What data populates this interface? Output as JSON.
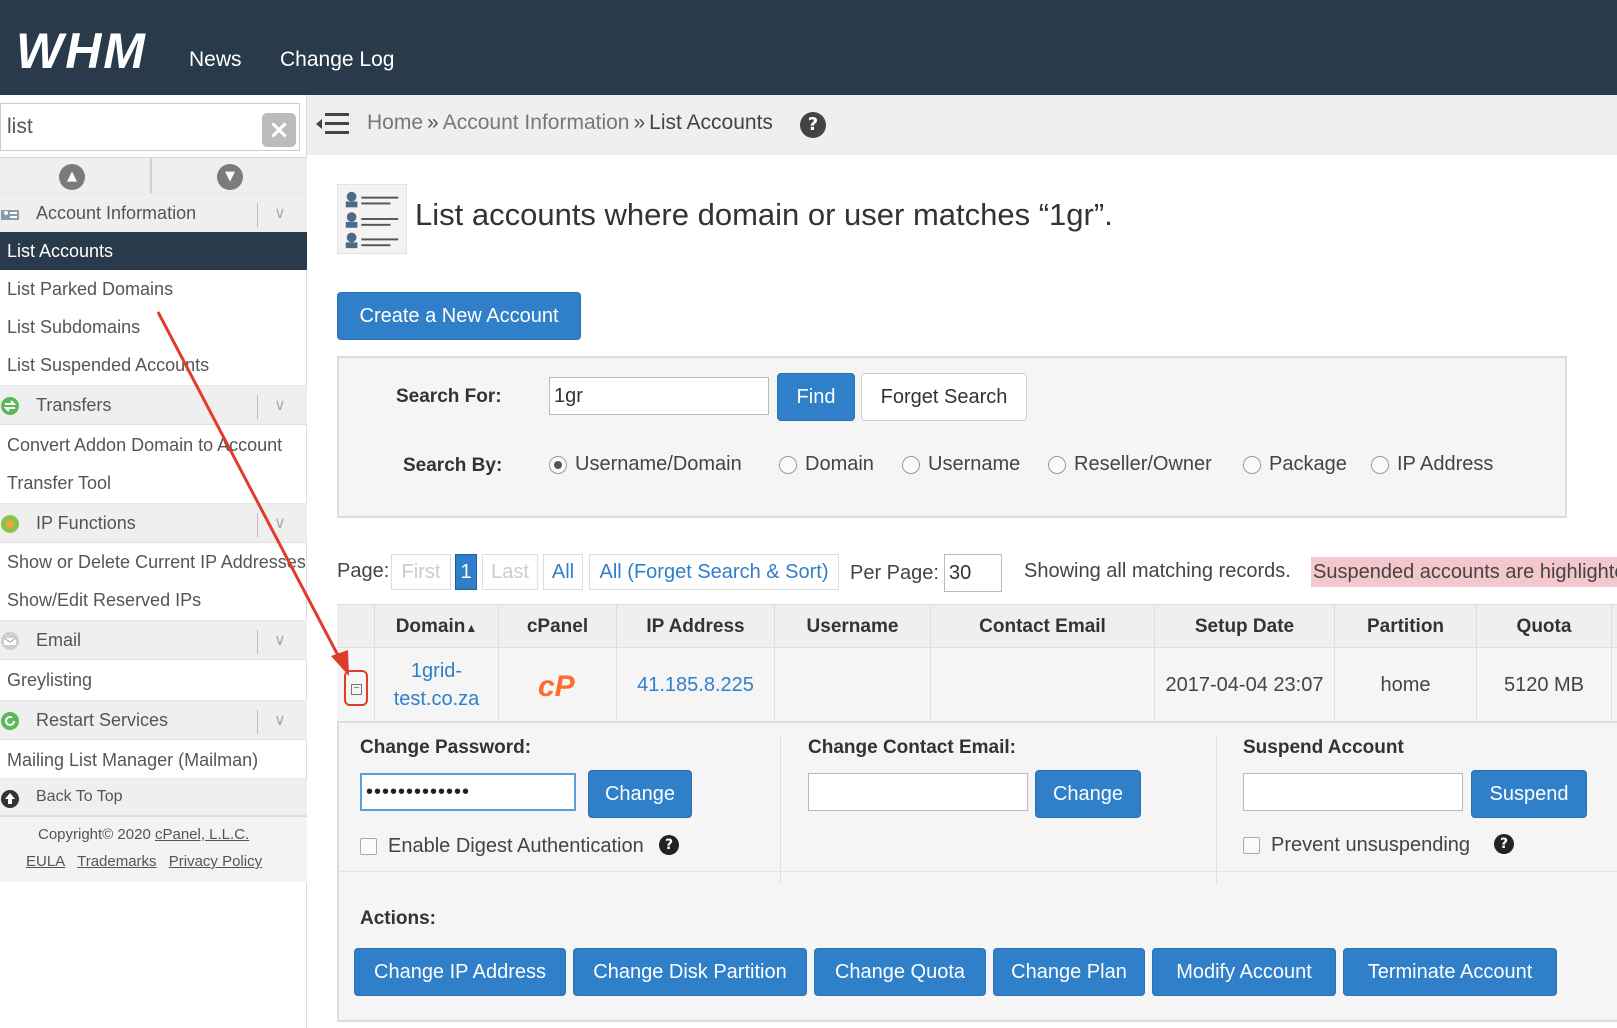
{
  "header": {
    "logo_text": "WHM",
    "nav": [
      "News",
      "Change Log"
    ]
  },
  "sidebar": {
    "search_value": "list",
    "clear_icon": "close-icon",
    "categories": [
      {
        "label": "Account Information",
        "icon": "account-info-icon",
        "items": [
          "List Accounts",
          "List Parked Domains",
          "List Subdomains",
          "List Suspended Accounts"
        ]
      },
      {
        "label": "Transfers",
        "icon": "transfers-icon",
        "items": [
          "Convert Addon Domain to Account",
          "Transfer Tool"
        ]
      },
      {
        "label": "IP Functions",
        "icon": "ip-functions-icon",
        "items": [
          "Show or Delete Current IP Addresses",
          "Show/Edit Reserved IPs"
        ]
      },
      {
        "label": "Email",
        "icon": "email-icon",
        "items": [
          "Greylisting"
        ]
      },
      {
        "label": "Restart Services",
        "icon": "restart-icon",
        "items": [
          "Mailing List Manager (Mailman)"
        ]
      }
    ],
    "back_to_top": "Back To Top",
    "footer": {
      "copyright_prefix": "Copyright© 2020",
      "company": "cPanel, L.L.C.",
      "links": [
        "EULA",
        "Trademarks",
        "Privacy Policy"
      ]
    }
  },
  "breadcrumb": {
    "home": "Home",
    "separator": "»",
    "section": "Account Information",
    "current": "List Accounts",
    "help_glyph": "?"
  },
  "main": {
    "title": "List accounts where domain or user matches “1gr”.",
    "create_button": "Create a New Account",
    "search": {
      "for_label": "Search For:",
      "value": "1gr",
      "find_button": "Find",
      "forget_button": "Forget Search",
      "by_label": "Search By:",
      "options": [
        "Username/Domain",
        "Domain",
        "Username",
        "Reseller/Owner",
        "Package",
        "IP Address"
      ],
      "selected": "Username/Domain"
    },
    "pagination": {
      "label": "Page:",
      "first": "First",
      "current": "1",
      "last": "Last",
      "all": "All",
      "all_forget": "All (Forget Search & Sort)",
      "per_page_label": "Per Page:",
      "per_page_value": "30",
      "showing_text": "Showing all matching records.",
      "suspended_note": "Suspended accounts are highlighted"
    },
    "table": {
      "columns": [
        "Domain",
        "cPanel",
        "IP Address",
        "Username",
        "Contact Email",
        "Setup Date",
        "Partition",
        "Quota"
      ],
      "sort_indicator": "▲",
      "rows": [
        {
          "domain_line1": "1grid-",
          "domain_line2": "test.co.za",
          "cpanel": "cP",
          "ip": "41.185.8.225",
          "username": "",
          "contact_email": "",
          "setup_date": "2017-04-04 23:07",
          "partition": "home",
          "quota": "5120 MB"
        }
      ]
    },
    "details": {
      "change_password_label": "Change Password:",
      "password_value": "•••••••••••••",
      "change_password_button": "Change",
      "digest_label": "Enable Digest Authentication",
      "change_email_label": "Change Contact Email:",
      "email_value": "",
      "change_email_button": "Change",
      "suspend_label": "Suspend Account",
      "suspend_value": "",
      "suspend_button": "Suspend",
      "prevent_label": "Prevent unsuspending",
      "help_glyph": "?",
      "actions_label": "Actions:",
      "actions": [
        "Change IP Address",
        "Change Disk Partition",
        "Change Quota",
        "Change Plan",
        "Modify Account",
        "Terminate Account"
      ]
    }
  },
  "colors": {
    "header_bg": "#293a4a",
    "accent_blue": "#2f7fc9",
    "annotation_red": "#e03c2c",
    "suspended_highlight": "#f4c7cc",
    "cpanel_orange": "#ff6c2c"
  }
}
